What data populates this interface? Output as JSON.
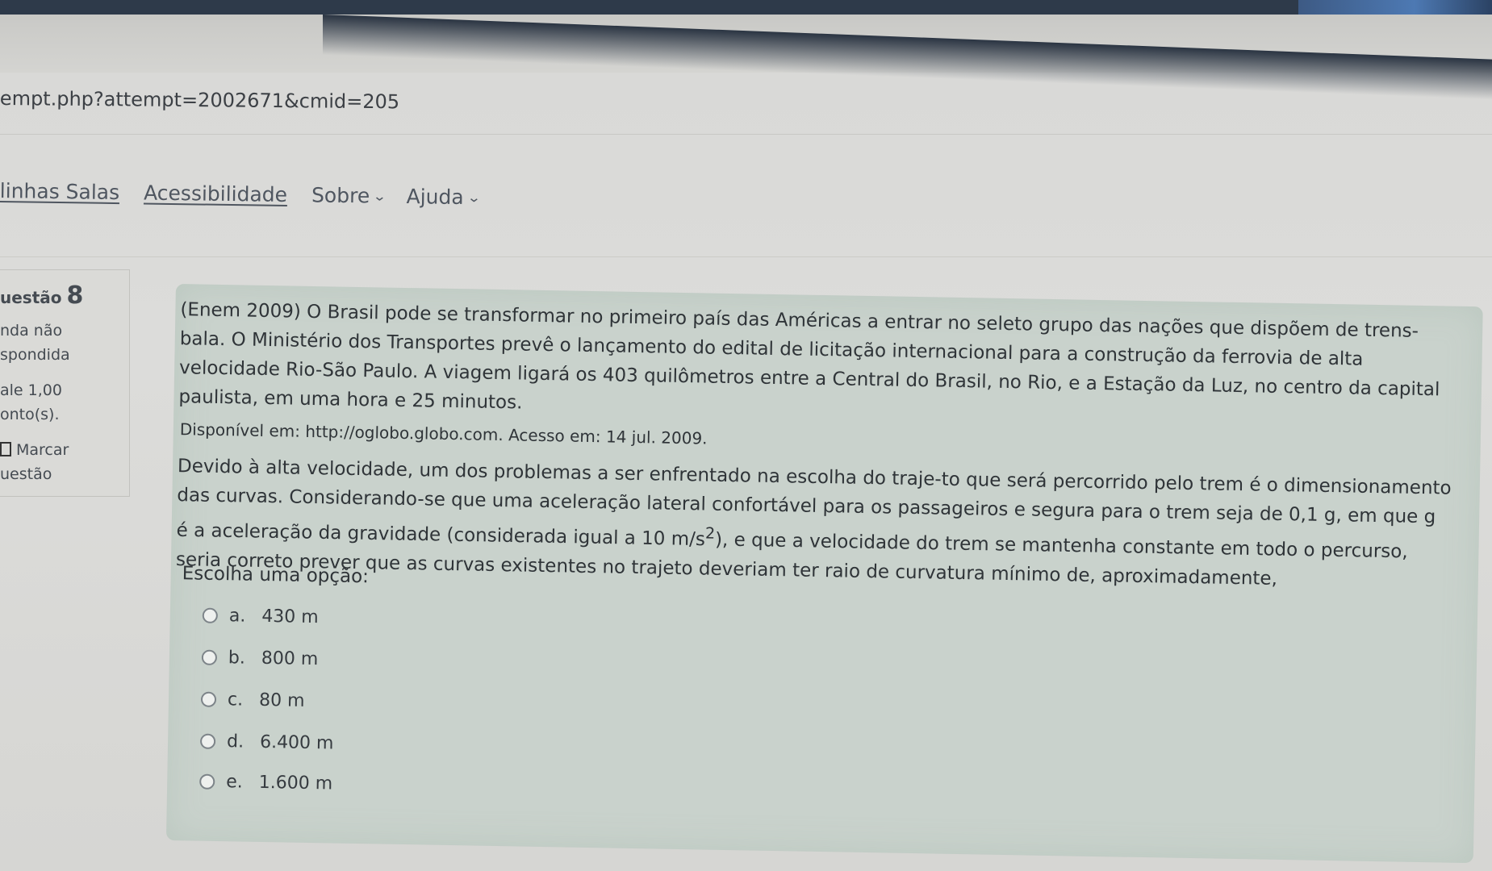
{
  "browser": {
    "url_fragment": "empt.php?attempt=2002671&cmid=205"
  },
  "nav": {
    "items": [
      {
        "label": "linhas Salas",
        "type": "link"
      },
      {
        "label": "Acessibilidade",
        "type": "link"
      },
      {
        "label": "Sobre",
        "type": "dropdown",
        "icon": "chevron-down-icon"
      },
      {
        "label": "Ajuda",
        "type": "dropdown",
        "icon": "chevron-down-icon"
      }
    ]
  },
  "question_info": {
    "title_prefix": "uestão",
    "number": "8",
    "status_line1": "nda não",
    "status_line2": "spondida",
    "grade_line": "ale 1,00",
    "points_line": "onto(s).",
    "flag_label": "Marcar",
    "flag_label2": "uestão"
  },
  "question": {
    "paragraph1": "(Enem 2009) O Brasil pode se transformar no primeiro país das Américas a entrar no seleto grupo das nações que dispõem de trens-bala. O Ministério dos Transportes prevê o lançamento do edital de licitação internacional para a construção da ferrovia de alta velocidade Rio-São Paulo. A viagem ligará os 403 quilômetros entre a Central do Brasil, no Rio, e a Estação da Luz, no centro da capital paulista, em uma hora e 25 minutos.",
    "source": "Disponível em: http://oglobo.globo.com. Acesso em: 14 jul. 2009.",
    "paragraph2_part1": "Devido à alta velocidade, um dos problemas a ser enfrentado na escolha do traje-to que será percorrido pelo trem é o dimensionamento das curvas. Considerando-se que uma aceleração lateral confortável para os passageiros e segura para o trem seja de 0,1 g, em que g é a aceleração da gravidade (considerada igual a 10 m/s",
    "paragraph2_sup": "2",
    "paragraph2_part2": "), e que a velocidade do trem se mantenha constante em todo o percurso, seria correto prever que as curvas existentes no trajeto deveriam ter raio de curvatura mínimo de, aproximadamente,",
    "prompt": "Escolha uma opção:",
    "options": [
      {
        "letter": "a.",
        "text": "430 m"
      },
      {
        "letter": "b.",
        "text": "800 m"
      },
      {
        "letter": "c.",
        "text": "80 m"
      },
      {
        "letter": "d.",
        "text": "6.400 m"
      },
      {
        "letter": "e.",
        "text": "1.600 m"
      }
    ]
  }
}
